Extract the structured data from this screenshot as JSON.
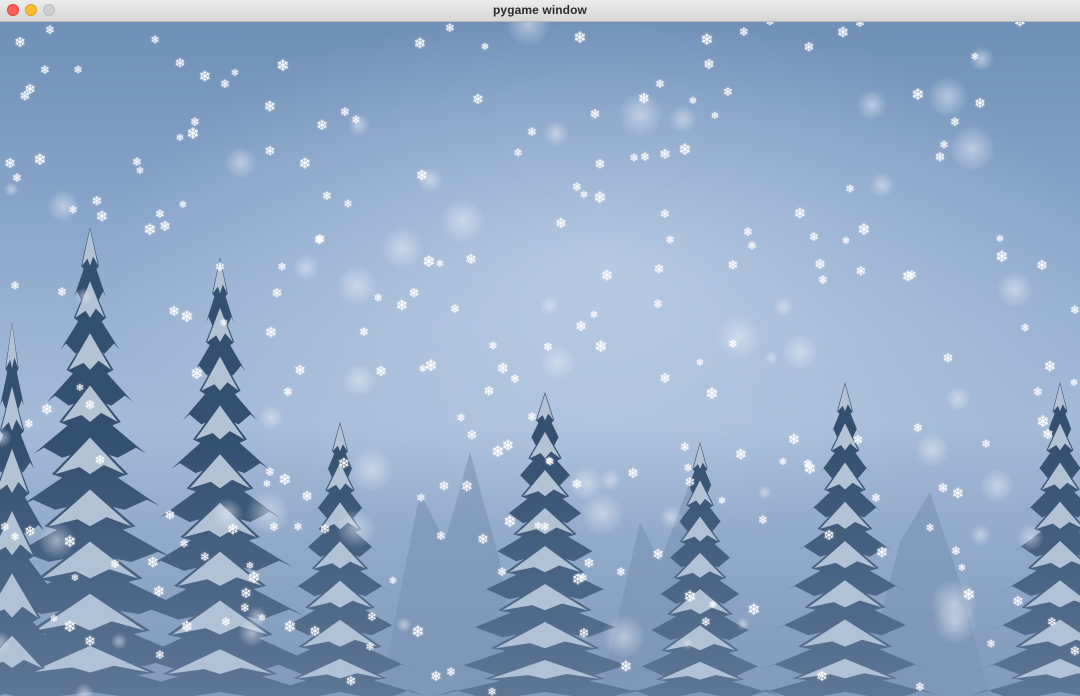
{
  "window": {
    "title": "pygame window"
  },
  "colors": {
    "sky_top": "#6f8fb6",
    "sky_mid": "#a4bbd7",
    "tree_dark": "#34506f",
    "tree_snow": "#c9d7e6",
    "flake": "#ffffff"
  },
  "icons": {
    "snowflake": "snowflake-icon"
  },
  "scene": {
    "description_free": true
  }
}
